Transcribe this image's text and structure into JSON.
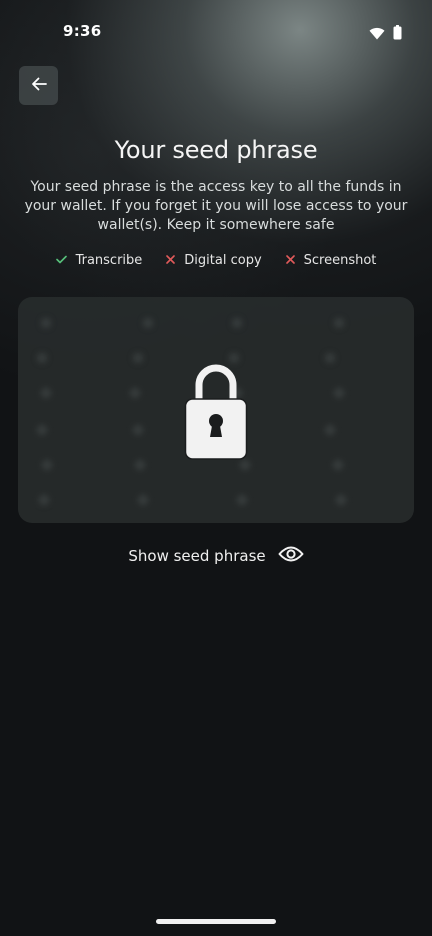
{
  "status_bar": {
    "time": "9:36",
    "icons": [
      "wifi-icon",
      "battery-icon"
    ]
  },
  "header": {
    "back_icon": "arrow-left-icon"
  },
  "main": {
    "title": "Your seed phrase",
    "description": "Your seed phrase is the access key to all the funds in your wallet. If you forget it you will lose access to your wallet(s). Keep it somewhere safe",
    "checklist": [
      {
        "label": "Transcribe",
        "status": "allowed",
        "color": "#57c07a"
      },
      {
        "label": "Digital copy",
        "status": "not-allowed",
        "color": "#e05a5a"
      },
      {
        "label": "Screenshot",
        "status": "not-allowed",
        "color": "#e05a5a"
      }
    ],
    "seed_card": {
      "locked": true,
      "lock_icon": "padlock-icon"
    },
    "reveal": {
      "label": "Show seed phrase",
      "icon": "eye-icon"
    }
  },
  "colors": {
    "background": "#111315",
    "card": "#2b2f2f",
    "text": "#f2f2f2",
    "check": "#57c07a",
    "cross": "#e05a5a"
  }
}
